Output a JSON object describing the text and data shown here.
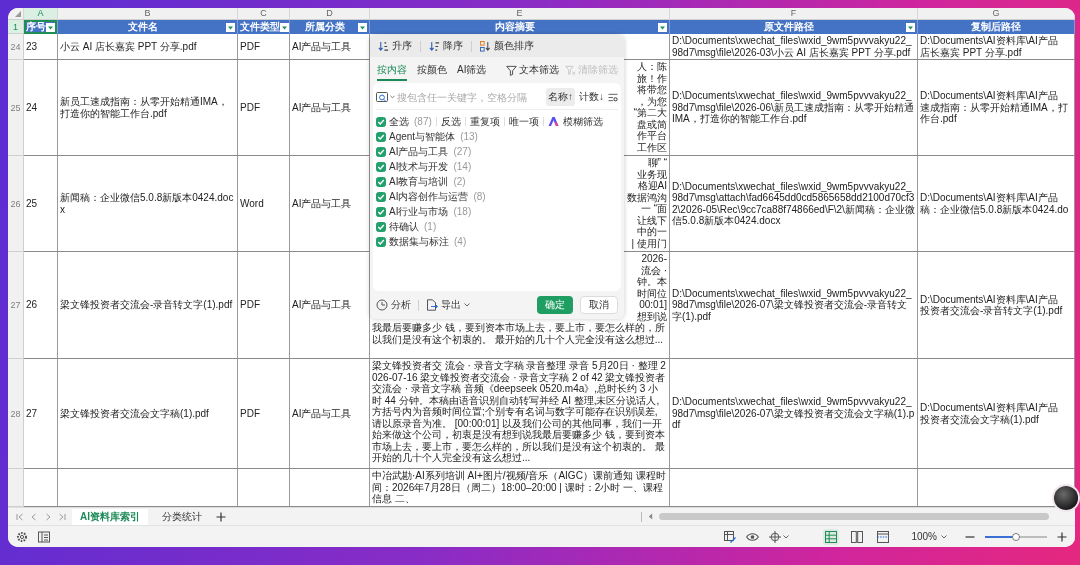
{
  "sheet": {
    "column_letters": [
      {
        "letter": "A",
        "selected": true
      },
      {
        "letter": "B",
        "selected": false
      },
      {
        "letter": "C",
        "selected": false
      },
      {
        "letter": "D",
        "selected": false
      },
      {
        "letter": "E",
        "selected": false
      },
      {
        "letter": "F",
        "selected": false
      },
      {
        "letter": "G",
        "selected": false
      }
    ],
    "header_row": {
      "number": "1",
      "selected": true
    },
    "columns": [
      {
        "title": "序号",
        "filter": true,
        "selected": true
      },
      {
        "title": "文件名",
        "filter": true,
        "selected": false
      },
      {
        "title": "文件类型",
        "filter": true,
        "selected": false
      },
      {
        "title": "所属分类",
        "filter": true,
        "selected": false
      },
      {
        "title": "内容摘要",
        "filter": true,
        "selected": false
      },
      {
        "title": "原文件路径",
        "filter": true,
        "selected": false
      },
      {
        "title": "复制后路径",
        "filter": false,
        "selected": false
      }
    ],
    "rows": [
      {
        "number": "24",
        "seq": "23",
        "file_name": "小云 AI 店长嘉宾 PPT 分享.pdf",
        "file_type": "PDF",
        "category": "AI产品与工具",
        "source_path": "D:\\Documents\\xwechat_files\\wxid_9wm5pvvvakyu22_98d7\\msg\\file\\2026-03\\小云 AI 店长嘉宾 PPT 分享.pdf",
        "copy_path_lines": [
          "D:\\Documents\\AI资料库\\AI产品",
          "店长嘉宾 PPT 分享.pdf"
        ]
      },
      {
        "number": "25",
        "seq": "24",
        "file_name": "新员工速成指南：从零开始精通IMA，打造你的智能工作台.pdf",
        "file_type": "PDF",
        "category": "AI产品与工具",
        "summary_fragments": [
          "人：陈",
          "旅！作",
          "将带您",
          "，为您",
          "“第二大",
          "盘或简",
          "作平台",
          "工作区"
        ],
        "source_path": "D:\\Documents\\xwechat_files\\wxid_9wm5pvvvakyu22_98d7\\msg\\file\\2026-06\\新员工速成指南：从零开始精通IMA，打造你的智能工作台.pdf",
        "copy_path_lines": [
          "D:\\Documents\\AI资料库\\AI产品",
          "速成指南：从零开始精通IMA，打",
          "作台.pdf"
        ]
      },
      {
        "number": "26",
        "seq": "25",
        "file_name": "新闻稿：企业微信5.0.8新版本0424.docx",
        "file_type": "Word",
        "category": "AI产品与工具",
        "summary_fragments": [
          "聊” “",
          "业务现",
          "格迎AI",
          "数据鸿沟",
          "一 “面",
          "让线下",
          "中的一",
          "| 使用门"
        ],
        "source_path": "D:\\Documents\\xwechat_files\\wxid_9wm5pvvvakyu22_98d7\\msg\\attach\\fad6645dd0cd5865658dd2100d70cf32\\2026-05\\Rec\\9cc7ca88f74866ed\\F\\2\\新闻稿：企业微信5.0.8新版本0424.docx",
        "copy_path_lines": [
          "D:\\Documents\\AI资料库\\AI产品",
          "稿：企业微信5.0.8新版本0424.do"
        ]
      },
      {
        "number": "27",
        "seq": "26",
        "file_name": "梁文锋投资者交流会-录音转文字(1).pdf",
        "file_type": "PDF",
        "category": "AI产品与工具",
        "summary_fragments": [
          "2026-",
          "流会 ·",
          "钟。本",
          "时间位",
          "00:01]",
          "想到说"
        ],
        "summary": "我最后要赚多少 钱，要到资本市场上去，要上市，要怎么样的，所以我们是没有这个初衷的。 最开始的几十个人完全没有这么想过...",
        "source_path": "D:\\Documents\\xwechat_files\\wxid_9wm5pvvvakyu22_98d7\\msg\\file\\2026-07\\梁文锋投资者交流会-录音转文字(1).pdf",
        "copy_path_lines": [
          "D:\\Documents\\AI资料库\\AI产品",
          "投资者交流会-录音转文字(1).pdf"
        ]
      },
      {
        "number": "28",
        "seq": "27",
        "file_name": "梁文锋投资者交流会文字稿(1).pdf",
        "file_type": "PDF",
        "category": "AI产品与工具",
        "summary": "梁文锋投资者交 流会 · 录音文字稿 录音整理 录音 5月20日 · 整理 2026-07-16 梁文锋投资者交流会 · 录音文字稿 2 of 42 梁文锋投资者交流会 · 录音文字稿 音频《deepseek 0520.m4a》,总时长约 3 小时 44 分钟。本稿由语音识别自动转写并经 AI 整理,未区分说话人,方括号内为音频时间位置;个别专有名词与数字可能存在识别误差, 请以原录音为准。 [00:00:01] 以及我们公司的其他同事，我们一开始来做这个公司，初衷是没有想到说我最后要赚多少 钱，要到资本市场上去，要上市，要怎么样的，所以我们是没有这个初衷的。 最开始的几十个人完全没有这么想过...",
        "source_path": "D:\\Documents\\xwechat_files\\wxid_9wm5pvvvakyu22_98d7\\msg\\file\\2026-07\\梁文锋投资者交流会文字稿(1).pdf",
        "copy_path_lines": [
          "D:\\Documents\\AI资料库\\AI产品",
          "投资者交流会文字稿(1).pdf"
        ]
      },
      {
        "summary": "中冶武勘·AI系列培训 AI+图片/视频/音乐（AIGC）课前通知 课程时间：2026年7月28日（周二）18:00–20:00 | 课时：2小时 一、课程信息 二、"
      }
    ]
  },
  "filter_popup": {
    "sort_buttons": [
      {
        "kind": "asc",
        "label": "升序"
      },
      {
        "kind": "desc",
        "label": "降序"
      },
      {
        "kind": "color",
        "label": "颜色排序"
      }
    ],
    "tabs": [
      {
        "label": "按内容",
        "selected": true
      },
      {
        "label": "按颜色",
        "selected": false
      },
      {
        "label": "AI筛选",
        "selected": false
      }
    ],
    "tools": [
      {
        "kind": "text_filter",
        "label": "文本筛选",
        "disabled": false
      },
      {
        "kind": "clear_filter",
        "label": "清除筛选",
        "disabled": true
      }
    ],
    "search": {
      "placeholder": "搜包含任一关键字，空格分隔"
    },
    "order_buttons": [
      {
        "label": "名称↑",
        "selected": true
      },
      {
        "label": "计数↓",
        "selected": false
      }
    ],
    "select_all": {
      "label": "全选",
      "count": "(87)",
      "checked": true
    },
    "actions": [
      "反选",
      "重复项",
      "唯一项"
    ],
    "fuzzy_filter": "模糊筛选",
    "items": [
      {
        "label": "Agent与智能体",
        "count": "(13)",
        "checked": true
      },
      {
        "label": "AI产品与工具",
        "count": "(27)",
        "checked": true
      },
      {
        "label": "AI技术与开发",
        "count": "(14)",
        "checked": true
      },
      {
        "label": "AI教育与培训",
        "count": "(2)",
        "checked": true
      },
      {
        "label": "AI内容创作与运营",
        "count": "(8)",
        "checked": true
      },
      {
        "label": "AI行业与市场",
        "count": "(18)",
        "checked": true
      },
      {
        "label": "待确认",
        "count": "(1)",
        "checked": true
      },
      {
        "label": "数据集与标注",
        "count": "(4)",
        "checked": true
      }
    ],
    "footer": [
      {
        "kind": "analysis",
        "label": "分析"
      },
      {
        "kind": "export",
        "label": "导出"
      }
    ],
    "confirm": "确定",
    "cancel": "取消"
  },
  "sheet_tabs": [
    {
      "label": "AI资料库索引",
      "selected": true
    },
    {
      "label": "分类统计",
      "selected": false
    }
  ],
  "status_bar": {
    "view_modes": [
      {
        "kind": "normal",
        "selected": true
      },
      {
        "kind": "page_layout",
        "selected": false
      },
      {
        "kind": "page_break",
        "selected": false
      }
    ],
    "zoom": {
      "value": "100%",
      "level": 0.5
    }
  }
}
